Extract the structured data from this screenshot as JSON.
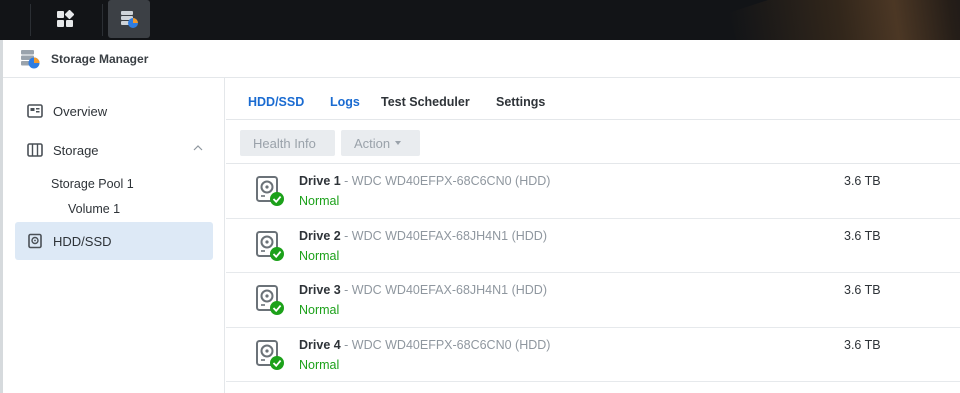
{
  "window": {
    "title": "Storage Manager"
  },
  "sidebar": {
    "items": [
      {
        "label": "Overview"
      },
      {
        "label": "Storage"
      },
      {
        "label": "HDD/SSD"
      }
    ],
    "storage_pool": "Storage Pool 1",
    "volume": "Volume 1"
  },
  "tabs": [
    "HDD/SSD",
    "Logs",
    "Test Scheduler",
    "Settings"
  ],
  "toolbar": {
    "health_label": "Health Info",
    "action_label": "Action"
  },
  "drives": [
    {
      "name": "Drive 1",
      "model": " - WDC WD40EFPX-68C6CN0 (HDD)",
      "status": "Normal",
      "size": "3.6 TB"
    },
    {
      "name": "Drive 2",
      "model": " - WDC WD40EFAX-68JH4N1 (HDD)",
      "status": "Normal",
      "size": "3.6 TB"
    },
    {
      "name": "Drive 3",
      "model": " - WDC WD40EFAX-68JH4N1 (HDD)",
      "status": "Normal",
      "size": "3.6 TB"
    },
    {
      "name": "Drive 4",
      "model": " - WDC WD40EFPX-68C6CN0 (HDD)",
      "status": "Normal",
      "size": "3.6 TB"
    }
  ],
  "colors": {
    "accent": "#1a6bd1",
    "status_ok": "#1ca11a",
    "active_bg": "#dde9f6",
    "taskbar": "#121417"
  }
}
